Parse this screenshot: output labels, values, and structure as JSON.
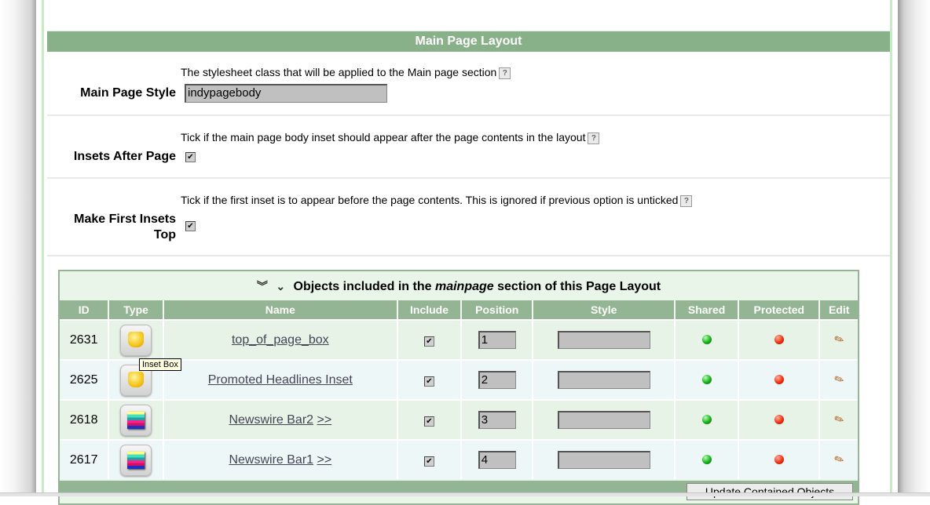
{
  "section": {
    "title": "Main Page Layout"
  },
  "settings": [
    {
      "label": "Main Page Style",
      "description": "The stylesheet class that will be applied to the Main page section",
      "value": "indypagebody",
      "type": "text"
    },
    {
      "label": "Insets After Page",
      "description": "Tick if the main page body inset should appear after the page contents in the layout",
      "checked": true,
      "type": "checkbox"
    },
    {
      "label_line1": "Make First Insets",
      "label_line2": "Top",
      "description": "Tick if the first inset is to appear before the page contents. This is ignored if previous option is unticked",
      "checked": true,
      "type": "checkbox"
    }
  ],
  "help_icon": "?",
  "objects": {
    "header_prefix": "Objects included in the ",
    "header_emphasis": "mainpage",
    "header_suffix": " section of this Page Layout",
    "expand_all_icon": "double-chevron-down-icon",
    "expand_icon": "chevron-down-icon",
    "columns": [
      "ID",
      "Type",
      "Name",
      "Include",
      "Position",
      "Style",
      "Shared",
      "Protected",
      "Edit"
    ],
    "rows": [
      {
        "id": "2631",
        "type": "inset-box",
        "name": "top_of_page_box",
        "more": "",
        "include": true,
        "position": "1",
        "style": "",
        "shared": "green",
        "protected": "red"
      },
      {
        "id": "2625",
        "type": "inset-box",
        "name": "Promoted Headlines Inset",
        "more": "",
        "include": true,
        "position": "2",
        "style": "",
        "shared": "green",
        "protected": "red"
      },
      {
        "id": "2618",
        "type": "newswire-bar",
        "name": "Newswire Bar2",
        "more": ">>",
        "include": true,
        "position": "3",
        "style": "",
        "shared": "green",
        "protected": "red"
      },
      {
        "id": "2617",
        "type": "newswire-bar",
        "name": "Newswire Bar1",
        "more": ">>",
        "include": true,
        "position": "4",
        "style": "",
        "shared": "green",
        "protected": "red"
      }
    ],
    "tooltip": "Inset Box",
    "update_button": "Update Contained Objects"
  },
  "colors": {
    "header_green": "#89b189",
    "table_header_green": "#93b593",
    "row_odd": "#e6f3e6",
    "row_even": "#eef7f7"
  }
}
